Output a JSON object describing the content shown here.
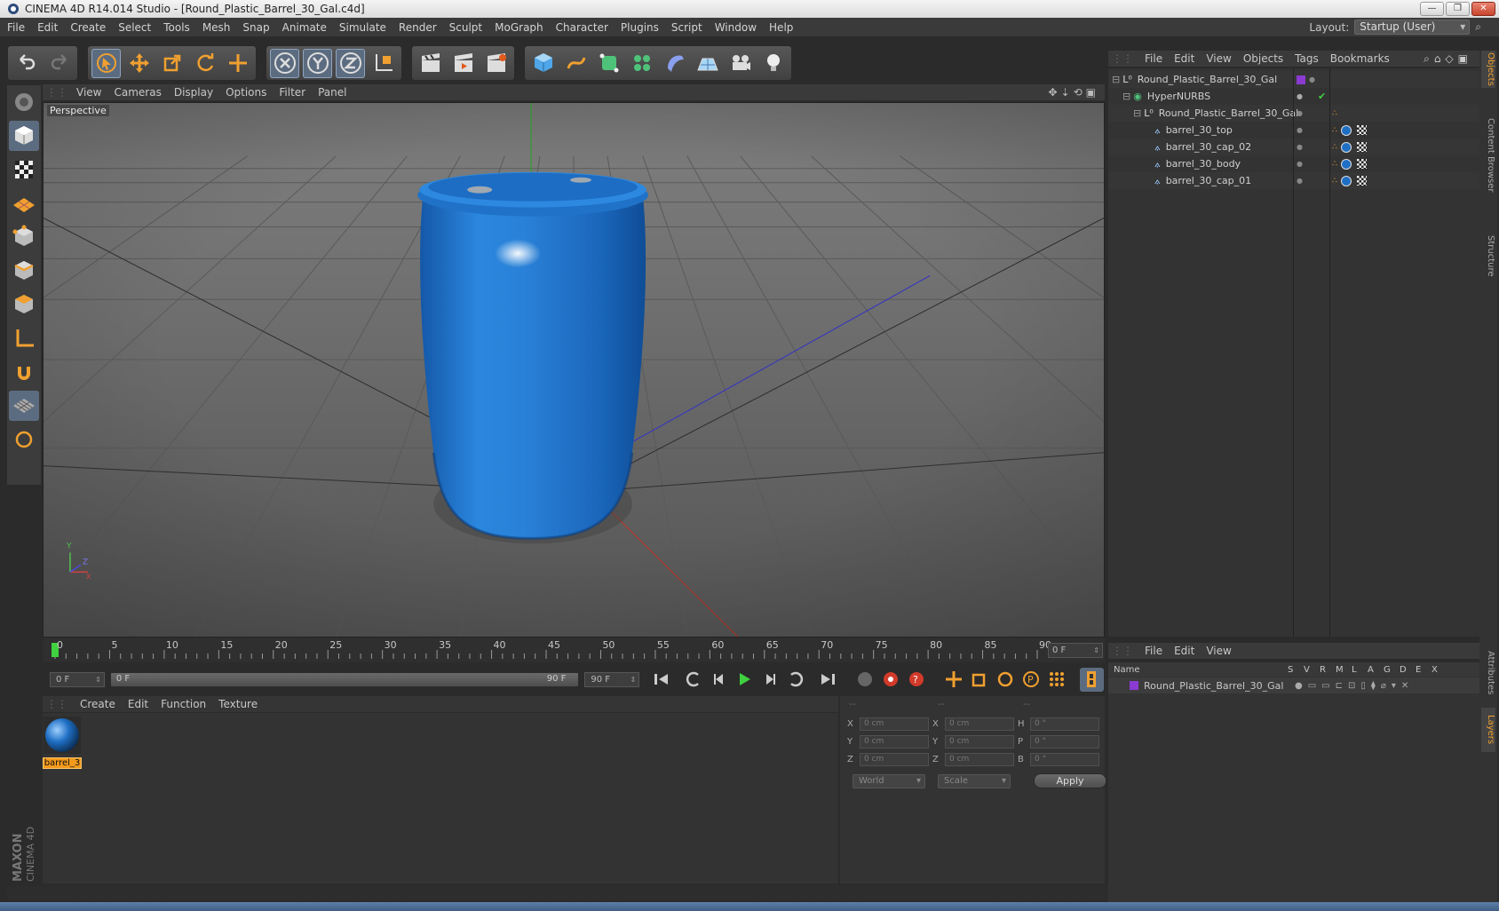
{
  "window": {
    "title": "CINEMA 4D R14.014 Studio - [Round_Plastic_Barrel_30_Gal.c4d]"
  },
  "menubar": {
    "items": [
      "File",
      "Edit",
      "Create",
      "Select",
      "Tools",
      "Mesh",
      "Snap",
      "Animate",
      "Simulate",
      "Render",
      "Sculpt",
      "MoGraph",
      "Character",
      "Plugins",
      "Script",
      "Window",
      "Help"
    ],
    "layout_label": "Layout:",
    "layout_value": "Startup (User)"
  },
  "viewport": {
    "menu": [
      "View",
      "Cameras",
      "Display",
      "Options",
      "Filter",
      "Panel"
    ],
    "camera_label": "Perspective",
    "axis_y": "Y",
    "axis_z": "Z",
    "axis_x": "X"
  },
  "timeline": {
    "ticks": [
      "0",
      "5",
      "10",
      "15",
      "20",
      "25",
      "30",
      "35",
      "40",
      "45",
      "50",
      "55",
      "60",
      "65",
      "70",
      "75",
      "80",
      "85",
      "90"
    ],
    "current_frame": "0 F",
    "start_field": "0 F",
    "slider_start": "0 F",
    "slider_end": "90 F",
    "end_field": "90 F"
  },
  "materials": {
    "menu": [
      "Create",
      "Edit",
      "Function",
      "Texture"
    ],
    "items": [
      {
        "label": "barrel_3"
      }
    ]
  },
  "coordinates": {
    "headers": [
      "--",
      "--",
      "--"
    ],
    "rows": [
      {
        "l1": "X",
        "v1": "0 cm",
        "l2": "X",
        "v2": "0 cm",
        "l3": "H",
        "v3": "0 °"
      },
      {
        "l1": "Y",
        "v1": "0 cm",
        "l2": "Y",
        "v2": "0 cm",
        "l3": "P",
        "v3": "0 °"
      },
      {
        "l1": "Z",
        "v1": "0 cm",
        "l2": "Z",
        "v2": "0 cm",
        "l3": "B",
        "v3": "0 °"
      }
    ],
    "mode_world": "World",
    "mode_scale": "Scale",
    "apply_label": "Apply"
  },
  "objects": {
    "menu": [
      "File",
      "Edit",
      "View",
      "Objects",
      "Tags",
      "Bookmarks"
    ],
    "tree": [
      {
        "name": "Round_Plastic_Barrel_30_Gal",
        "indent": 0,
        "type": "null"
      },
      {
        "name": "HyperNURBS",
        "indent": 1,
        "type": "nurbs"
      },
      {
        "name": "Round_Plastic_Barrel_30_Gal",
        "indent": 2,
        "type": "null"
      },
      {
        "name": "barrel_30_top",
        "indent": 3,
        "type": "poly"
      },
      {
        "name": "barrel_30_cap_02",
        "indent": 3,
        "type": "poly"
      },
      {
        "name": "barrel_30_body",
        "indent": 3,
        "type": "poly"
      },
      {
        "name": "barrel_30_cap_01",
        "indent": 3,
        "type": "poly"
      }
    ]
  },
  "layers": {
    "menu": [
      "File",
      "Edit",
      "View"
    ],
    "columns": [
      "Name",
      "S",
      "V",
      "R",
      "M",
      "L",
      "A",
      "G",
      "D",
      "E",
      "X"
    ],
    "rows": [
      {
        "name": "Round_Plastic_Barrel_30_Gal"
      }
    ]
  },
  "right_tabs": [
    "Objects",
    "Content Browser",
    "Structure",
    "Attributes",
    "Layers"
  ],
  "branding": {
    "maxon": "MAXON",
    "cinema": "CINEMA 4D"
  },
  "colors": {
    "accent": "#f39a1d",
    "barrel": "#1f73c8",
    "active_tool": "#5c6c80",
    "layer": "#8b3bd1"
  }
}
